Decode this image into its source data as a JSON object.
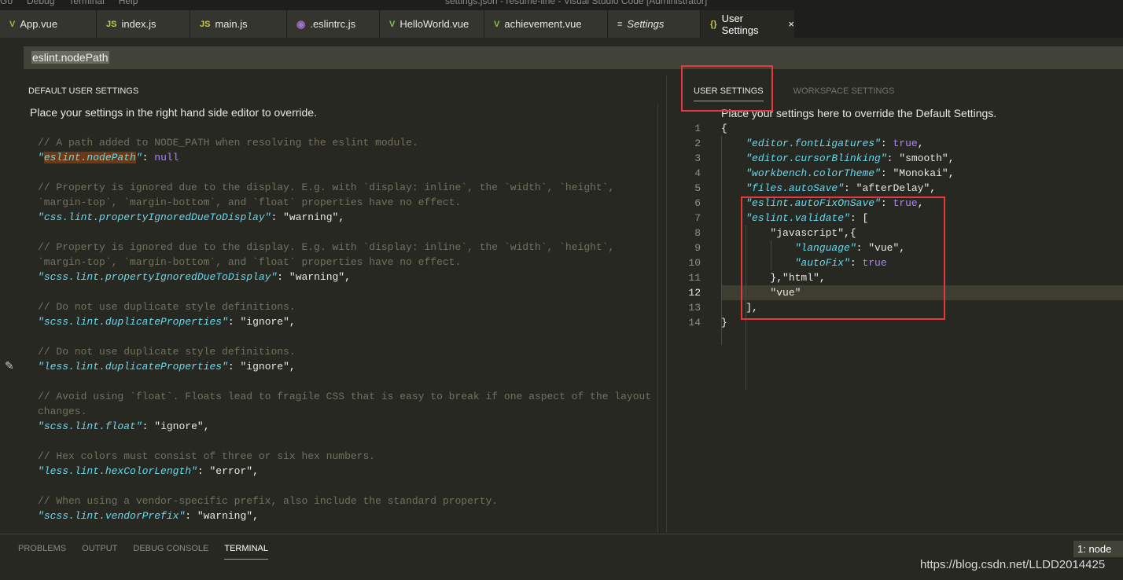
{
  "titlebar": {
    "menus": [
      "Go",
      "Debug",
      "Terminal",
      "Help"
    ],
    "title": "settings.json - resume-line - Visual Studio Code [Administrator]"
  },
  "tabs": [
    {
      "label": "App.vue",
      "icon": "vue-icon",
      "glyph": "V",
      "cls": "vue"
    },
    {
      "label": "index.js",
      "icon": "js-icon",
      "glyph": "JS",
      "cls": "js"
    },
    {
      "label": "main.js",
      "icon": "js-icon",
      "glyph": "JS",
      "cls": "js"
    },
    {
      "label": ".eslintrc.js",
      "icon": "eslint-icon",
      "glyph": "◉",
      "cls": "es"
    },
    {
      "label": "HelloWorld.vue",
      "icon": "vue-icon",
      "glyph": "V",
      "cls": "vue"
    },
    {
      "label": "achievement.vue",
      "icon": "vue-icon",
      "glyph": "V",
      "cls": "vue"
    },
    {
      "label": "Settings",
      "icon": "settings-list-icon",
      "glyph": "≡",
      "cls": "set",
      "italic": true
    },
    {
      "label": "User Settings",
      "icon": "json-braces-icon",
      "glyph": "{}",
      "cls": "br",
      "active": true,
      "close": "×"
    }
  ],
  "search": {
    "value": "eslint.nodePath"
  },
  "left": {
    "header": "DEFAULT USER SETTINGS",
    "description": "Place your settings in the right hand side editor to override.",
    "entries": [
      {
        "comment": [
          "// A path added to NODE_PATH when resolving the eslint module."
        ],
        "key": "eslint.nodePath",
        "value": "null",
        "vtype": "b",
        "comma": "",
        "highlight": true
      },
      {
        "comment": [
          "// Property is ignored due to the display. E.g. with `display: inline`, the `width`, `height`,",
          "`margin-top`, `margin-bottom`, and `float` properties have no effect."
        ],
        "key": "css.lint.propertyIgnoredDueToDisplay",
        "value": "\"warning\"",
        "vtype": "s",
        "comma": ","
      },
      {
        "comment": [
          "// Property is ignored due to the display. E.g. with `display: inline`, the `width`, `height`,",
          "`margin-top`, `margin-bottom`, and `float` properties have no effect."
        ],
        "key": "scss.lint.propertyIgnoredDueToDisplay",
        "value": "\"warning\"",
        "vtype": "s",
        "comma": ","
      },
      {
        "comment": [
          "// Do not use duplicate style definitions."
        ],
        "key": "scss.lint.duplicateProperties",
        "value": "\"ignore\"",
        "vtype": "s",
        "comma": ","
      },
      {
        "comment": [
          "// Do not use duplicate style definitions."
        ],
        "key": "less.lint.duplicateProperties",
        "value": "\"ignore\"",
        "vtype": "s",
        "comma": ","
      },
      {
        "comment": [
          "// Avoid using `float`. Floats lead to fragile CSS that is easy to break if one aspect of the layout",
          "changes."
        ],
        "key": "scss.lint.float",
        "value": "\"ignore\"",
        "vtype": "s",
        "comma": ","
      },
      {
        "comment": [
          "// Hex colors must consist of three or six hex numbers."
        ],
        "key": "less.lint.hexColorLength",
        "value": "\"error\"",
        "vtype": "s",
        "comma": ","
      },
      {
        "comment": [
          "// When using a vendor-specific prefix, also include the standard property."
        ],
        "key": "scss.lint.vendorPrefix",
        "value": "\"warning\"",
        "vtype": "s",
        "comma": ","
      }
    ]
  },
  "right": {
    "tabs": [
      {
        "label": "USER SETTINGS",
        "active": true
      },
      {
        "label": "WORKSPACE SETTINGS"
      }
    ],
    "description": "Place your settings here to override the Default Settings.",
    "current_line": 12,
    "lines": [
      [
        [
          "p",
          "{"
        ]
      ],
      [
        [
          "p",
          "    "
        ],
        [
          "k",
          "\"editor.fontLigatures\""
        ],
        [
          "p",
          ": "
        ],
        [
          "b",
          "true"
        ],
        [
          "p",
          ","
        ]
      ],
      [
        [
          "p",
          "    "
        ],
        [
          "k",
          "\"editor.cursorBlinking\""
        ],
        [
          "p",
          ": "
        ],
        [
          "s",
          "\"smooth\""
        ],
        [
          "p",
          ","
        ]
      ],
      [
        [
          "p",
          "    "
        ],
        [
          "k",
          "\"workbench.colorTheme\""
        ],
        [
          "p",
          ": "
        ],
        [
          "s",
          "\"Monokai\""
        ],
        [
          "p",
          ","
        ]
      ],
      [
        [
          "p",
          "    "
        ],
        [
          "k",
          "\"files.autoSave\""
        ],
        [
          "p",
          ": "
        ],
        [
          "s",
          "\"afterDelay\""
        ],
        [
          "p",
          ","
        ]
      ],
      [
        [
          "p",
          "    "
        ],
        [
          "k",
          "\"eslint.autoFixOnSave\""
        ],
        [
          "p",
          ": "
        ],
        [
          "b",
          "true"
        ],
        [
          "p",
          ","
        ]
      ],
      [
        [
          "p",
          "    "
        ],
        [
          "k",
          "\"eslint.validate\""
        ],
        [
          "p",
          ": ["
        ]
      ],
      [
        [
          "p",
          "        "
        ],
        [
          "s",
          "\"javascript\""
        ],
        [
          "p",
          ",{"
        ]
      ],
      [
        [
          "p",
          "            "
        ],
        [
          "k",
          "\"language\""
        ],
        [
          "p",
          ": "
        ],
        [
          "s",
          "\"vue\""
        ],
        [
          "p",
          ","
        ]
      ],
      [
        [
          "p",
          "            "
        ],
        [
          "k",
          "\"autoFix\""
        ],
        [
          "p",
          ": "
        ],
        [
          "b",
          "true"
        ]
      ],
      [
        [
          "p",
          "        },"
        ],
        [
          "s",
          "\"html\""
        ],
        [
          "p",
          ","
        ]
      ],
      [
        [
          "p",
          "        "
        ],
        [
          "s",
          "\"vue\""
        ]
      ],
      [
        [
          "p",
          "    ],"
        ]
      ],
      [
        [
          "p",
          "}"
        ]
      ]
    ]
  },
  "panel": {
    "tabs": [
      "PROBLEMS",
      "OUTPUT",
      "DEBUG CONSOLE",
      "TERMINAL"
    ],
    "active": "TERMINAL",
    "terminal_select": "1: node"
  },
  "watermark": "https://blog.csdn.net/LLDD2014425",
  "colors": {
    "background": "#272822",
    "key": "#66d9ef",
    "constant": "#ae81ff",
    "comment": "#75715e",
    "annotation_box": "#e8383d"
  }
}
